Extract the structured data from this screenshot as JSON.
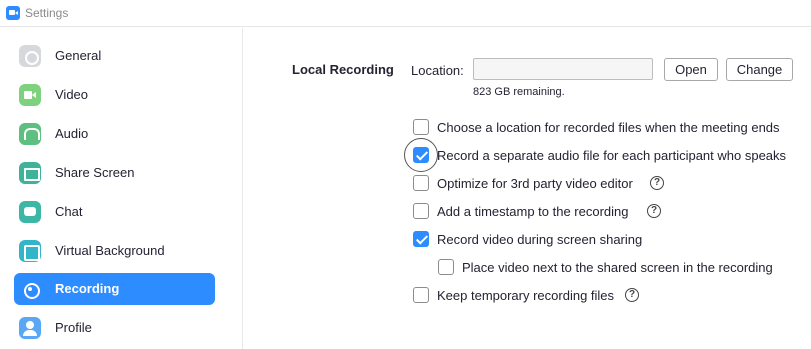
{
  "window": {
    "title": "Settings"
  },
  "sidebar": {
    "items": [
      {
        "label": "General",
        "icon": "gear-icon",
        "active": false
      },
      {
        "label": "Video",
        "icon": "video-camera-icon",
        "active": false
      },
      {
        "label": "Audio",
        "icon": "headphones-icon",
        "active": false
      },
      {
        "label": "Share Screen",
        "icon": "share-screen-icon",
        "active": false
      },
      {
        "label": "Chat",
        "icon": "chat-bubble-icon",
        "active": false
      },
      {
        "label": "Virtual Background",
        "icon": "virtual-background-icon",
        "active": false
      },
      {
        "label": "Recording",
        "icon": "record-icon",
        "active": true
      },
      {
        "label": "Profile",
        "icon": "profile-icon",
        "active": false
      }
    ]
  },
  "recording": {
    "section_title": "Local Recording",
    "location_label": "Location:",
    "location_value": "",
    "open_label": "Open",
    "change_label": "Change",
    "remaining": "823 GB remaining.",
    "options": [
      {
        "label": "Choose a location for recorded files when the meeting ends",
        "checked": false,
        "help": false
      },
      {
        "label": "Record a separate audio file for each participant who speaks",
        "checked": true,
        "help": false
      },
      {
        "label": "Optimize for 3rd party video editor",
        "checked": false,
        "help": true
      },
      {
        "label": "Add a timestamp to the recording",
        "checked": false,
        "help": true
      },
      {
        "label": "Record video during screen sharing",
        "checked": true,
        "help": false
      },
      {
        "label": "Place video next to the shared screen in the recording",
        "checked": false,
        "help": false
      },
      {
        "label": "Keep temporary recording files",
        "checked": false,
        "help": true
      }
    ],
    "help_glyph": "?"
  },
  "colors": {
    "accent": "#2d8cff",
    "text": "#232333"
  }
}
